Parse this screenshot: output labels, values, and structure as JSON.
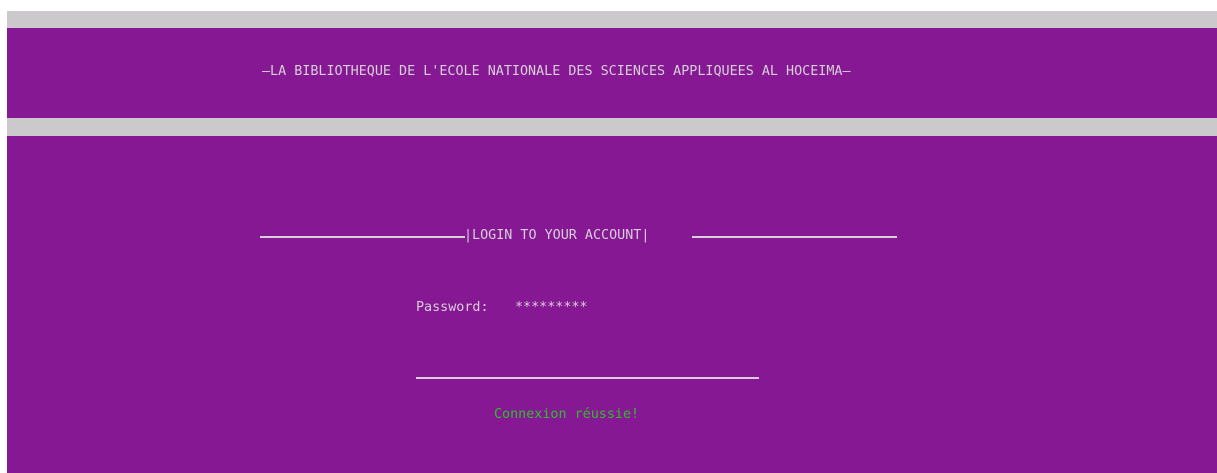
{
  "header": {
    "title": "—LA BIBLIOTHEQUE DE L'ECOLE NATIONALE DES SCIENCES APPLIQUEES AL HOCEIMA—"
  },
  "login": {
    "heading": "|LOGIN TO YOUR ACCOUNT|",
    "password_label": "Password:",
    "password_value": "*********",
    "status_message": "Connexion réussie!"
  },
  "colors": {
    "background": "#871893",
    "separator": "#ccc9cd",
    "text": "#d6cfd9",
    "success": "#2fbe2f"
  }
}
